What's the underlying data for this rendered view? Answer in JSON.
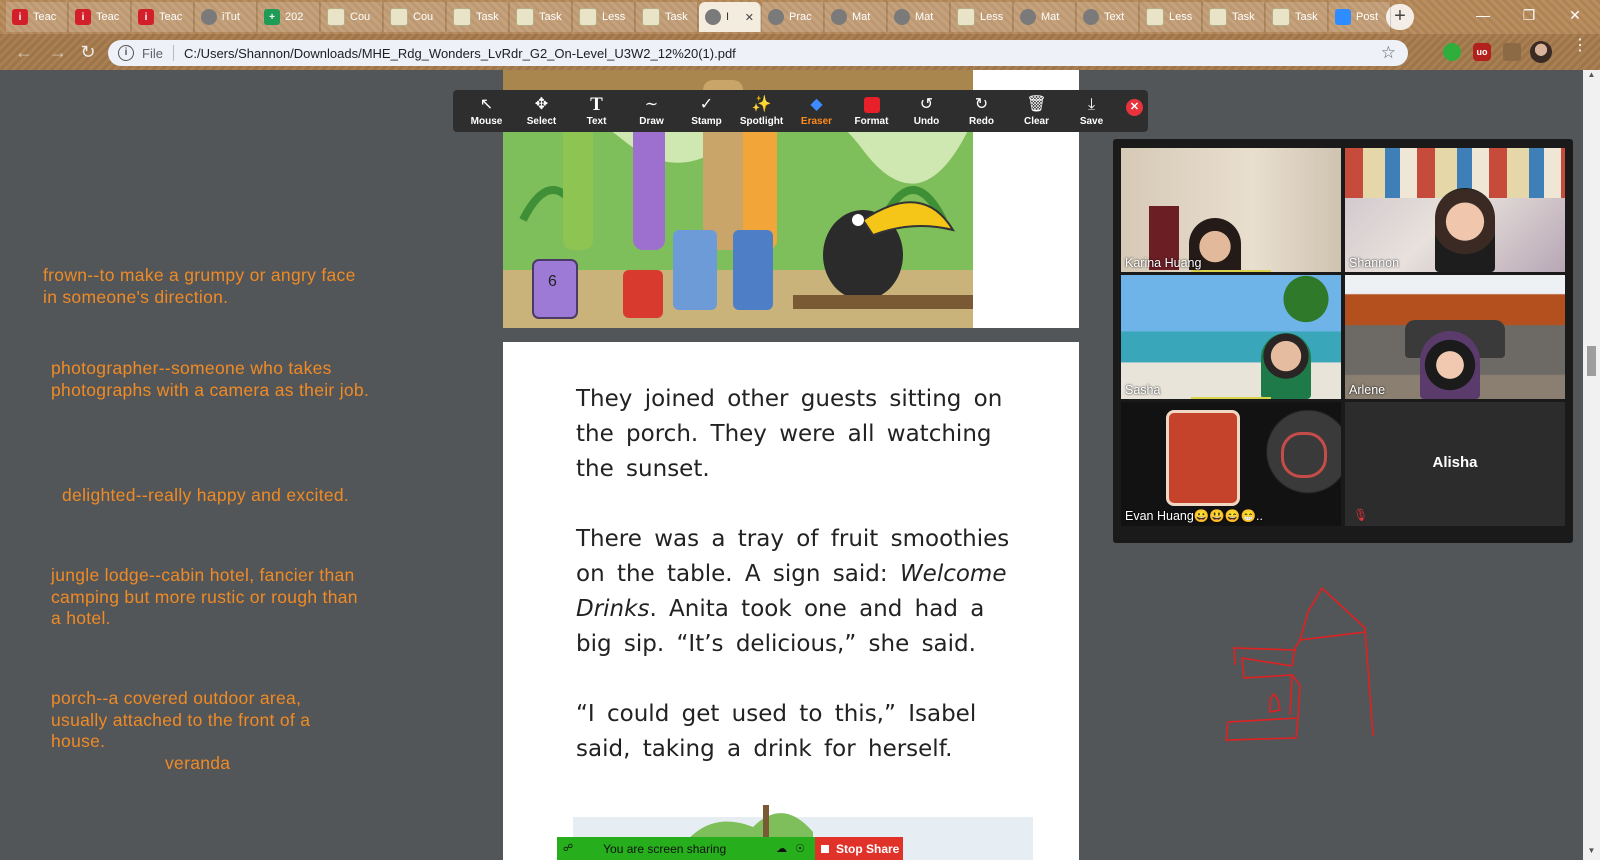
{
  "browser": {
    "tabs": [
      {
        "label": "Teac",
        "icon": "i-logo-icon",
        "color": "#d21f2a"
      },
      {
        "label": "Teac",
        "icon": "i-logo-icon",
        "color": "#d21f2a"
      },
      {
        "label": "Teac",
        "icon": "i-logo-icon",
        "color": "#d21f2a"
      },
      {
        "label": "iTut",
        "icon": "globe-icon",
        "color": "#7a7a7a"
      },
      {
        "label": "202",
        "icon": "sheets-plus-icon",
        "color": "#1e9c55"
      },
      {
        "label": "Cou",
        "icon": "doc-person-icon",
        "color": "#e9e4c8"
      },
      {
        "label": "Cou",
        "icon": "doc-person-icon",
        "color": "#e9e4c8"
      },
      {
        "label": "Task",
        "icon": "doc-person-icon",
        "color": "#e9e4c8"
      },
      {
        "label": "Task",
        "icon": "doc-person-icon",
        "color": "#e9e4c8"
      },
      {
        "label": "Less",
        "icon": "doc-person-icon",
        "color": "#e9e4c8"
      },
      {
        "label": "Task",
        "icon": "doc-person-icon",
        "color": "#e9e4c8"
      },
      {
        "label": "I",
        "icon": "globe-icon",
        "color": "#7a7a7a",
        "active": true
      },
      {
        "label": "Prac",
        "icon": "globe-icon",
        "color": "#7a7a7a"
      },
      {
        "label": "Mat",
        "icon": "globe-icon",
        "color": "#7a7a7a"
      },
      {
        "label": "Mat",
        "icon": "globe-icon",
        "color": "#7a7a7a"
      },
      {
        "label": "Less",
        "icon": "doc-person-icon",
        "color": "#e9e4c8"
      },
      {
        "label": "Mat",
        "icon": "globe-icon",
        "color": "#7a7a7a"
      },
      {
        "label": "Text",
        "icon": "globe-icon",
        "color": "#7a7a7a"
      },
      {
        "label": "Less",
        "icon": "doc-person-icon",
        "color": "#e9e4c8"
      },
      {
        "label": "Task",
        "icon": "doc-person-icon",
        "color": "#e9e4c8"
      },
      {
        "label": "Task",
        "icon": "doc-person-icon",
        "color": "#e9e4c8"
      },
      {
        "label": "Post",
        "icon": "zoom-icon",
        "color": "#2d8cff"
      }
    ],
    "address": {
      "scheme_label": "File",
      "url": "C:/Users/Shannon/Downloads/MHE_Rdg_Wonders_LvRdr_G2_On-Level_U3W2_12%20(1).pdf"
    }
  },
  "pdf": {
    "picture_number": "6",
    "paragraphs": [
      {
        "before": "They joined other guests sitting on the porch. They were all watching the sunset.",
        "em": "",
        "after": ""
      },
      {
        "before": "There was a tray of fruit smoothies on the table. A sign said: ",
        "em": "Welcome Drinks",
        "after": ". Anita took one and had a big sip. “It’s delicious,” she said."
      },
      {
        "before": "“I could get used to this,” Isabel said, taking a drink for herself.",
        "em": "",
        "after": ""
      }
    ]
  },
  "notes": [
    "frown--to make a grumpy or angry face in someone's direction.",
    "photographer--someone who takes photographs with a camera as their job.",
    "delighted--really happy and excited.",
    "jungle lodge--cabin hotel, fancier than camping but more rustic or rough than a hotel.",
    "porch--a covered outdoor area, usually attached to the front of a house.",
    "veranda"
  ],
  "annotate_toolbar": {
    "tools": [
      {
        "label": "Mouse",
        "icon": "mouse-pointer-icon"
      },
      {
        "label": "Select",
        "icon": "move-arrows-icon"
      },
      {
        "label": "Text",
        "icon": "text-T-icon"
      },
      {
        "label": "Draw",
        "icon": "draw-wave-icon"
      },
      {
        "label": "Stamp",
        "icon": "stamp-check-icon"
      },
      {
        "label": "Spotlight",
        "icon": "spotlight-wand-icon"
      },
      {
        "label": "Eraser",
        "icon": "eraser-icon",
        "active": true
      },
      {
        "label": "Format",
        "icon": "format-red-square-icon"
      },
      {
        "label": "Undo",
        "icon": "undo-icon"
      },
      {
        "label": "Redo",
        "icon": "redo-icon"
      },
      {
        "label": "Clear",
        "icon": "trash-icon"
      },
      {
        "label": "Save",
        "icon": "save-download-icon"
      }
    ],
    "accent": "#ff8a1c"
  },
  "participants": [
    {
      "name": "Karina Huang",
      "speaking": true
    },
    {
      "name": "Shannon"
    },
    {
      "name": "Sasha",
      "speaking": true
    },
    {
      "name": "Arlene"
    },
    {
      "name": "Evan Huang😀😃😄😁.."
    },
    {
      "name": "Alisha",
      "muted": true
    }
  ],
  "share_bar": {
    "status": "You are screen sharing",
    "stop_label": "Stop Share"
  }
}
